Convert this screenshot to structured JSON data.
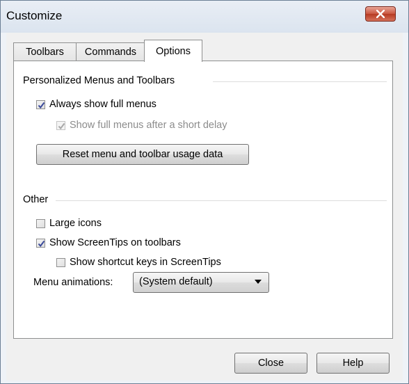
{
  "window": {
    "title": "Customize"
  },
  "tabs": [
    {
      "label": "Toolbars",
      "active": false
    },
    {
      "label": "Commands",
      "active": false
    },
    {
      "label": "Options",
      "active": true
    }
  ],
  "options": {
    "personalized": {
      "heading": "Personalized Menus and Toolbars",
      "always_show_full_menus": {
        "label": "Always show full menus",
        "checked": true,
        "enabled": true
      },
      "show_after_delay": {
        "label": "Show full menus after a short delay",
        "checked": true,
        "enabled": false
      },
      "reset_button": "Reset menu and toolbar usage data"
    },
    "other": {
      "heading": "Other",
      "large_icons": {
        "label": "Large icons",
        "checked": false,
        "enabled": true
      },
      "show_screentips": {
        "label": "Show ScreenTips on toolbars",
        "checked": true,
        "enabled": true
      },
      "show_shortcut_keys": {
        "label": "Show shortcut keys in ScreenTips",
        "checked": false,
        "enabled": true
      },
      "menu_animations_label": "Menu animations:",
      "menu_animations_value": "(System default)"
    }
  },
  "buttons": {
    "close": "Close",
    "help": "Help"
  },
  "colors": {
    "checkmark": "#3a4a9a",
    "checkmark_disabled": "#a8a8a8",
    "close_button": "#c9553f"
  }
}
